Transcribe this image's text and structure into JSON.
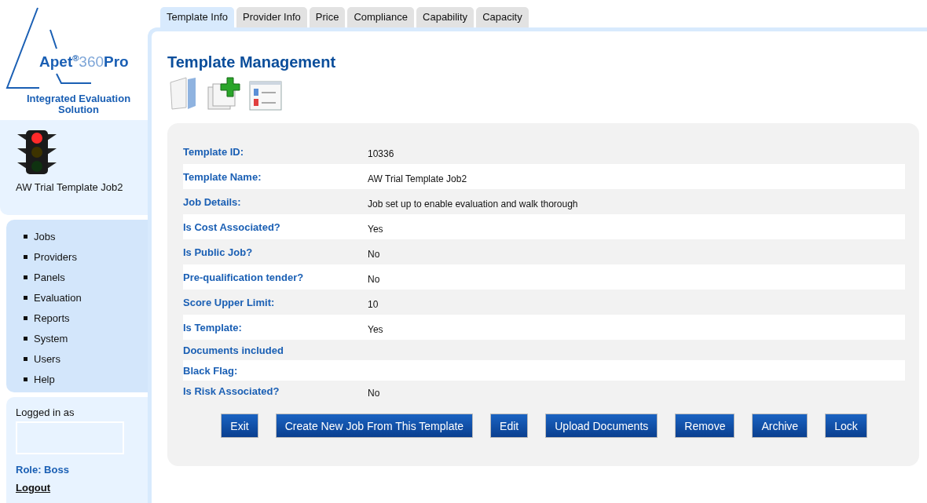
{
  "logo": {
    "brand": "Apet",
    "mark": "®",
    "suffix": "360",
    "pro": "Pro",
    "tagline": "Integrated Evaluation Solution"
  },
  "job_card": {
    "lights": [
      {
        "on": true
      },
      {
        "on": false
      },
      {
        "on": false
      }
    ],
    "title": "AW Trial Template Job2"
  },
  "nav": [
    "Jobs",
    "Providers",
    "Panels",
    "Evaluation",
    "Reports",
    "System",
    "Users",
    "Help"
  ],
  "login": {
    "label": "Logged in as",
    "role": "Role: Boss",
    "logout": "Logout"
  },
  "tabs": [
    {
      "label": "Template Info",
      "selected": true
    },
    {
      "label": "Provider Info",
      "selected": false
    },
    {
      "label": "Price",
      "selected": false
    },
    {
      "label": "Compliance",
      "selected": false
    },
    {
      "label": "Capability",
      "selected": false
    },
    {
      "label": "Capacity",
      "selected": false
    }
  ],
  "heading": "Template Management",
  "details": [
    {
      "label": "Template ID:",
      "value": "10336"
    },
    {
      "label": "Template Name:",
      "value": "AW Trial Template Job2"
    },
    {
      "label": "Job Details:",
      "value": "Job set up to enable evaluation and walk thorough"
    },
    {
      "label": "Is Cost Associated?",
      "value": "Yes"
    },
    {
      "label": "Is Public Job?",
      "value": "No"
    },
    {
      "label": "Pre-qualification tender?",
      "value": "No"
    },
    {
      "label": "Score Upper Limit:",
      "value": "10"
    },
    {
      "label": "Is Template:",
      "value": "Yes"
    },
    {
      "label": "Documents included"
    },
    {
      "label": "Black Flag:"
    },
    {
      "label": "Is Risk Associated?",
      "value": "No"
    }
  ],
  "buttons": [
    "Exit",
    "Create New Job From This Template",
    "Edit",
    "Upload Documents",
    "Remove",
    "Archive",
    "Lock"
  ]
}
